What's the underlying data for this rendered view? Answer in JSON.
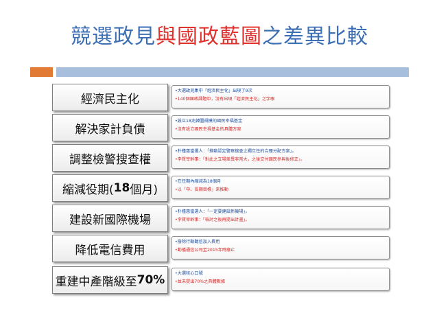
{
  "title": {
    "part1": "競選政見",
    "part2": "與",
    "part3": "國政藍圖",
    "part4": "之差異比較"
  },
  "colors": {
    "title_blue": "#3d6fb4",
    "title_red": "#e0312d",
    "bar_orange": "#e07a35",
    "bar_blue": "#a7bedc",
    "detail_blue": "#1f4e9c",
    "detail_red": "#d42a2a"
  },
  "rows": [
    {
      "label": "經濟民主化",
      "line1": "•大選政見集中「經濟民主化」出現了9次",
      "line2": "•140個國政課題中，沒有出現「經濟民主化」之字眼"
    },
    {
      "label": "解決家計負債",
      "line1": "•設立18兆韓圜規模的國民幸福基金",
      "line2": "•沒有設立國民幸福基金的具體方案"
    },
    {
      "label": "調整檢警搜查權",
      "line1": "•朴槿惠當選人：「推動認定警察搜查之獨立性的合理分配方案」。",
      "line2": "•李賢宰幹事：「對此之立場差異非常大，之後交付國民參與後修正」。"
    },
    {
      "label_main": "縮減役期(",
      "label_bold": "18",
      "label_tail": "個月)",
      "line1": "•在任期內縮減為18個月",
      "line2": "•以「中、長期目標」來推動"
    },
    {
      "label": "建設新國際機場",
      "line1": "•朴槿惠當選人：「一定要建設新機場」。",
      "line2": "•李賢宰幹事：「檢討之後再提出計畫」。"
    },
    {
      "label": "降低電信費用",
      "line1": "•廢除行動聽信加入費用",
      "line2": "•動播通信公司至2015年時廢止"
    },
    {
      "label_main": "重建中產階級至",
      "label_bold": "70%",
      "line1": "•大選核心口號",
      "line2": "•並未提出70%之具體數據"
    }
  ]
}
